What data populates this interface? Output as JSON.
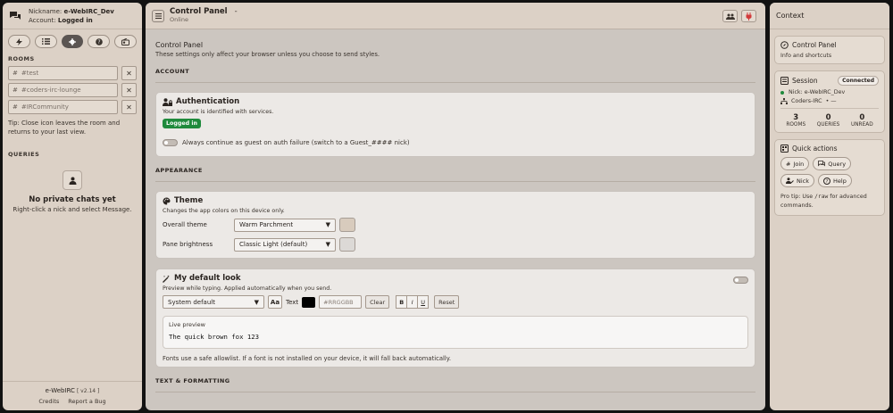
{
  "left": {
    "nickname_label": "Nickname:",
    "nickname": "e-WebIRC_Dev",
    "account_label": "Account:",
    "account_status": "Logged in",
    "rooms_title": "ROOMS",
    "rooms": [
      "#test",
      "#coders-irc-lounge",
      "#IRCommunity"
    ],
    "tip": "Tip: Close icon leaves the room and returns to your last view.",
    "queries_title": "QUERIES",
    "empty_title": "No private chats yet",
    "empty_sub": "Right-click a nick and select Message.",
    "brand": "e-WebIRC",
    "version": "[ v2.14 ]",
    "credits": "Credits",
    "report": "Report a Bug"
  },
  "main": {
    "title": "Control Panel",
    "title_dash": "-",
    "status": "Online",
    "cp_title": "Control Panel",
    "cp_sub": "These settings only affect your browser unless you choose to send styles.",
    "account_group": "ACCOUNT",
    "auth_title": "Authentication",
    "auth_sub": "Your account is identified with services.",
    "auth_badge": "Logged in",
    "guest_toggle": "Always continue as guest on auth failure (switch to a Guest_#### nick)",
    "appearance_group": "APPEARANCE",
    "theme_title": "Theme",
    "theme_sub": "Changes the app colors on this device only.",
    "overall_label": "Overall theme",
    "overall_value": "Warm Parchment",
    "overall_swatch": "#d8cbbd",
    "pane_label": "Pane brightness",
    "pane_value": "Classic Light (default)",
    "pane_swatch": "#dcd9d6",
    "look_title": "My default look",
    "look_sub": "Preview while typing. Applied automatically when you send.",
    "font_value": "System default",
    "aa": "Aa",
    "text_label": "Text",
    "hex_placeholder": "#RRGGBB",
    "clear": "Clear",
    "bold": "B",
    "italic": "I",
    "underline": "U",
    "reset": "Reset",
    "preview_label": "Live preview",
    "preview_text": "The quick brown fox 123",
    "font_note": "Fonts use a safe allowlist. If a font is not installed on your device, it will fall back automatically.",
    "text_group": "TEXT & FORMATTING"
  },
  "right": {
    "title": "Context",
    "cp_title": "Control Panel",
    "cp_sub": "Info and shortcuts",
    "session_title": "Session",
    "connected": "Connected",
    "nick_line": "Nick: e-WebIRC_Dev",
    "network_line": "Coders-IRC",
    "network_extra": "• —",
    "rooms_n": "3",
    "rooms_l": "ROOMS",
    "queries_n": "0",
    "queries_l": "QUERIES",
    "unread_n": "0",
    "unread_l": "UNREAD",
    "qa_title": "Quick actions",
    "join": "Join",
    "query": "Query",
    "nick": "Nick",
    "help": "Help",
    "tip_pre": "Pro tip: Use",
    "tip_code": "/raw",
    "tip_post": "for advanced commands."
  },
  "colors": {
    "accent_green": "#1f8a3c",
    "active_tab": "#5b5552",
    "power_red": "#d23a3a"
  }
}
